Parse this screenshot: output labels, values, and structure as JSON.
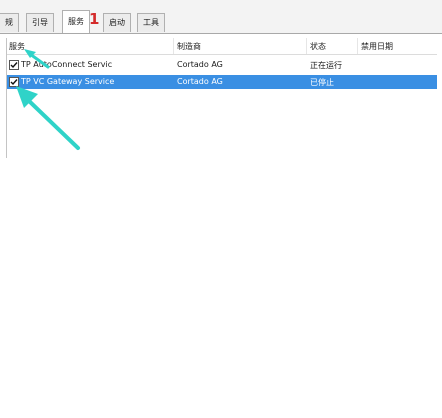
{
  "tabs": [
    {
      "label": "规",
      "active": false
    },
    {
      "label": "引导",
      "active": false
    },
    {
      "label": "服务",
      "active": true
    },
    {
      "label": "启动",
      "active": false
    },
    {
      "label": "工具",
      "active": false
    }
  ],
  "annotation": {
    "number": "1",
    "color": "#d42b2b",
    "arrow_color": "#2fd3c8"
  },
  "services": {
    "columns": {
      "service": "服务",
      "vendor": "制造商",
      "status": "状态",
      "disable_date": "禁用日期"
    },
    "rows": [
      {
        "checked": true,
        "name": "TP AutoConnect Servic",
        "vendor": "Cortado AG",
        "status": "正在运行",
        "selected": false
      },
      {
        "checked": true,
        "name": "TP VC Gateway Service",
        "vendor": "Cortado AG",
        "status": "已停止",
        "selected": true
      }
    ],
    "selection_color": "#3a8fe3"
  }
}
